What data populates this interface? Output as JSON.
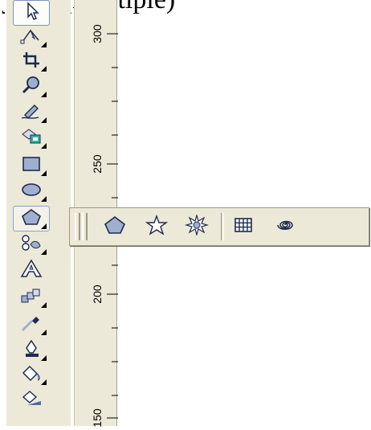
{
  "document": {
    "visible_text": "ygon (Multiple)"
  },
  "toolbox": {
    "tools": [
      {
        "name": "pick-tool",
        "icon": "pointer-icon"
      },
      {
        "name": "shape-tool",
        "icon": "shape-node-icon"
      },
      {
        "name": "crop-tool",
        "icon": "crop-icon"
      },
      {
        "name": "zoom-tool",
        "icon": "magnifier-icon"
      },
      {
        "name": "freehand-tool",
        "icon": "pencil-icon"
      },
      {
        "name": "smart-fill-tool",
        "icon": "smart-fill-icon"
      },
      {
        "name": "rectangle-tool",
        "icon": "rectangle-icon"
      },
      {
        "name": "ellipse-tool",
        "icon": "ellipse-icon"
      },
      {
        "name": "polygon-tool",
        "icon": "polygon-icon"
      },
      {
        "name": "basic-shapes-tool",
        "icon": "basic-shapes-icon"
      },
      {
        "name": "text-tool",
        "icon": "text-a-icon"
      },
      {
        "name": "interactive-blend-tool",
        "icon": "blend-icon"
      },
      {
        "name": "eyedropper-tool",
        "icon": "eyedropper-icon"
      },
      {
        "name": "outline-tool",
        "icon": "pen-nib-icon"
      },
      {
        "name": "fill-tool",
        "icon": "paint-bucket-icon"
      },
      {
        "name": "interactive-fill-tool",
        "icon": "interactive-fill-icon"
      }
    ]
  },
  "ruler": {
    "labels": [
      "300",
      "250",
      "200",
      "150"
    ]
  },
  "flyout": {
    "items": [
      {
        "name": "polygon-option",
        "icon": "pentagon-icon"
      },
      {
        "name": "star-option",
        "icon": "star-icon"
      },
      {
        "name": "complex-star-option",
        "icon": "complex-star-icon"
      },
      {
        "name": "graph-paper-option",
        "icon": "grid-icon"
      },
      {
        "name": "spiral-option",
        "icon": "spiral-icon"
      }
    ]
  },
  "colors": {
    "panel": "#ece9d8",
    "icon_fill": "#9fb0cf",
    "icon_stroke": "#1e2a50"
  }
}
